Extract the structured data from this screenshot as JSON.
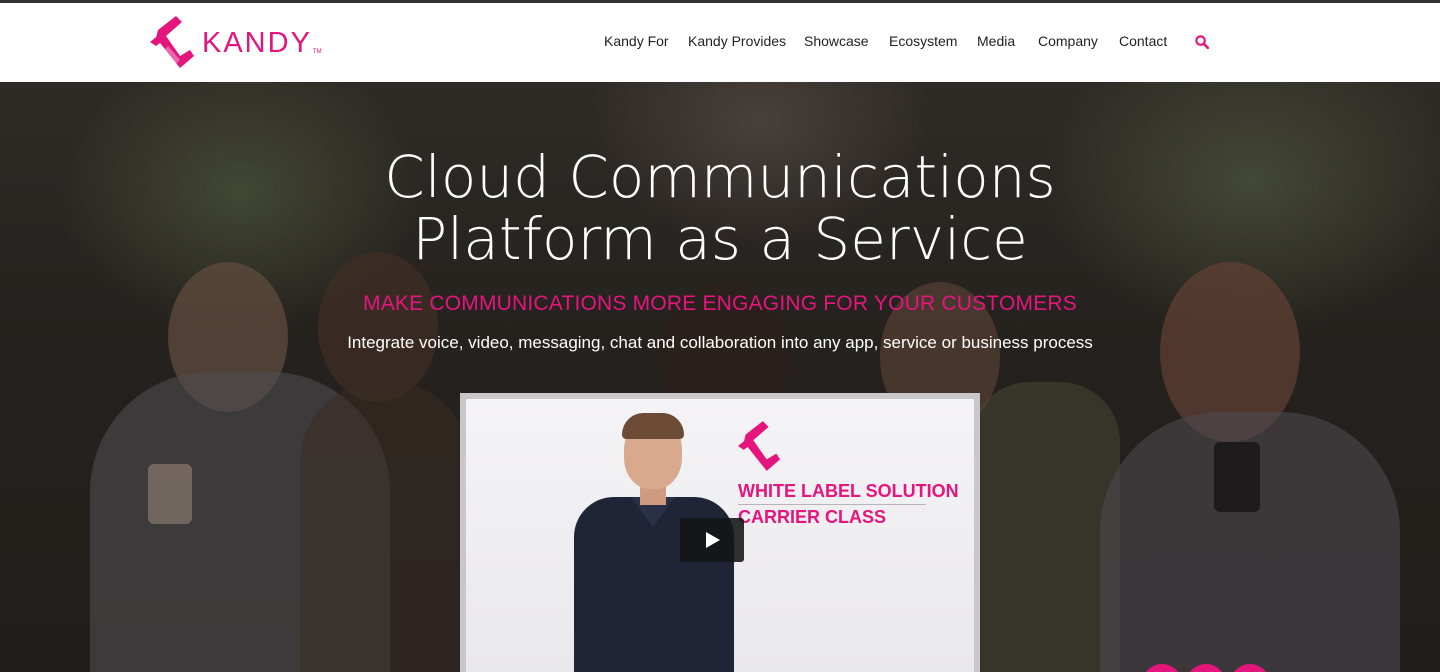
{
  "brand": {
    "name": "KANDY",
    "tm": "TM",
    "accent": "#e5157e"
  },
  "nav": {
    "items": [
      {
        "label": "Kandy For"
      },
      {
        "label": "Kandy Provides"
      },
      {
        "label": "Showcase"
      },
      {
        "label": "Ecosystem"
      },
      {
        "label": "Media"
      },
      {
        "label": "Company"
      },
      {
        "label": "Contact"
      }
    ],
    "search_icon": "search-icon"
  },
  "hero": {
    "title_line1": "Cloud Communications",
    "title_line2": "Platform as a Service",
    "tagline": "MAKE COMMUNICATIONS MORE ENGAGING FOR YOUR CUSTOMERS",
    "subtitle": "Integrate voice, video, messaging, chat and collaboration into any app, service or business process"
  },
  "video": {
    "line1": "WHITE LABEL SOLUTION",
    "line2": "CARRIER CLASS",
    "play_icon": "play-icon"
  }
}
